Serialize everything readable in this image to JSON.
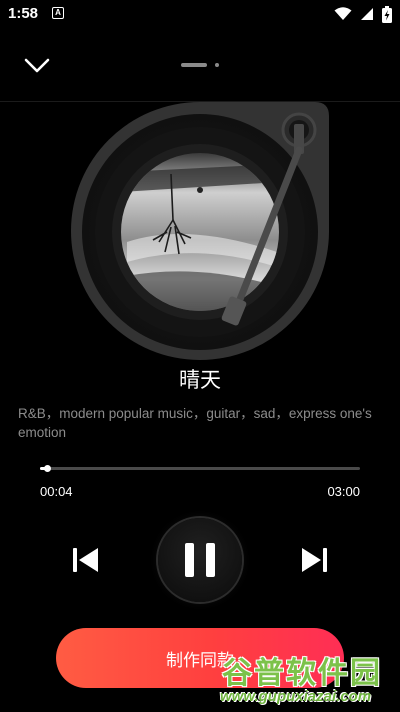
{
  "status_bar": {
    "time": "1:58",
    "notification_glyph": "A",
    "icons": [
      "wifi-icon",
      "signal-icon",
      "battery-icon"
    ]
  },
  "header": {
    "collapse_icon": "chevron-down-icon",
    "page_indicator": {
      "pages": 2,
      "active": 0
    }
  },
  "player": {
    "title": "晴天",
    "tags": "R&B，modern popular music，guitar，sad，express one's emotion",
    "current_time": "00:04",
    "total_time": "03:00",
    "progress": 0.022,
    "controls": {
      "previous_icon": "skip-previous-icon",
      "pause_icon": "pause-icon",
      "next_icon": "skip-next-icon"
    }
  },
  "action": {
    "make_label": "制作同款"
  },
  "watermark": {
    "main": "谷普软件园",
    "url": "www.gupuxiazai.com"
  },
  "colors": {
    "background": "#000000",
    "accent_start": "#ff5c43",
    "accent_end": "#ff2e55",
    "muted_text": "#8c8c8c"
  }
}
